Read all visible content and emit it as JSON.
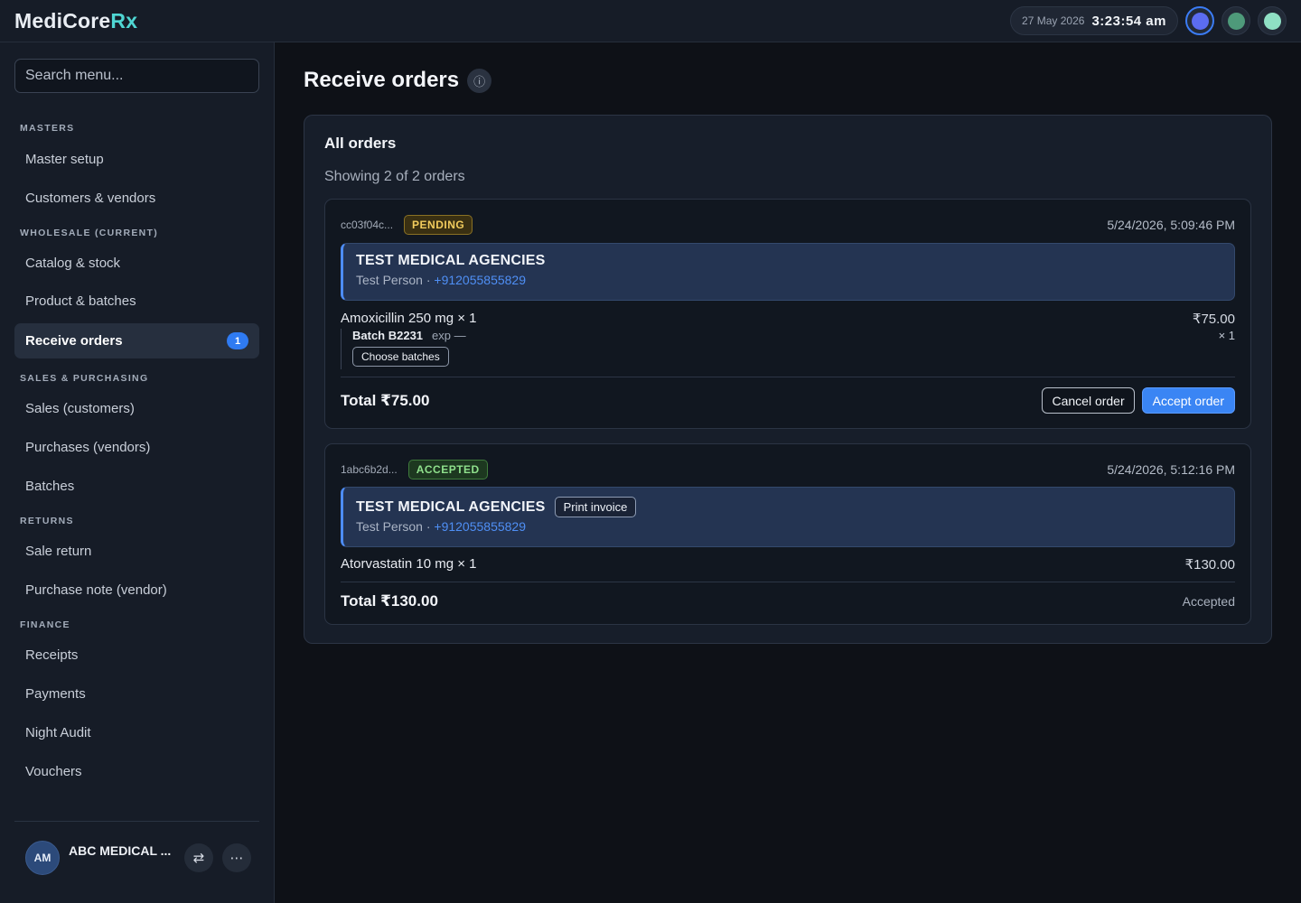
{
  "app": {
    "brand_main": "MediCore",
    "brand_accent": "Rx",
    "clock_date": "27 May 2026",
    "clock_time": "3:23:54 am",
    "themes": [
      {
        "name": "indigo",
        "color": "#5b6cf0"
      },
      {
        "name": "green",
        "color": "#4e9a7a"
      },
      {
        "name": "mint",
        "color": "#8fe0c4"
      }
    ]
  },
  "sidebar": {
    "search_placeholder": "Search menu...",
    "sections": [
      {
        "label": "MASTERS",
        "items": [
          {
            "label": "Master setup"
          },
          {
            "label": "Customers & vendors"
          }
        ]
      },
      {
        "label": "WHOLESALE (CURRENT)",
        "items": [
          {
            "label": "Catalog & stock"
          },
          {
            "label": "Product & batches"
          },
          {
            "label": "Receive orders",
            "badge": "1",
            "active": true
          }
        ]
      },
      {
        "label": "SALES & PURCHASING",
        "items": [
          {
            "label": "Sales (customers)"
          },
          {
            "label": "Purchases (vendors)"
          },
          {
            "label": "Batches"
          }
        ]
      },
      {
        "label": "RETURNS",
        "items": [
          {
            "label": "Sale return"
          },
          {
            "label": "Purchase note (vendor)"
          }
        ]
      },
      {
        "label": "FINANCE",
        "items": [
          {
            "label": "Receipts"
          },
          {
            "label": "Payments"
          },
          {
            "label": "Night Audit"
          },
          {
            "label": "Vouchers"
          }
        ]
      }
    ],
    "account": {
      "initials": "AM",
      "name": "ABC MEDICAL ...",
      "switch_icon": "⇄",
      "more_icon": "⋯"
    }
  },
  "main": {
    "title": "Receive orders",
    "info_icon": "ⓘ",
    "panel_title": "All orders",
    "panel_subtitle": "Showing 2 of 2 orders",
    "orders": [
      {
        "id": "cc03f04c...",
        "status": "PENDING",
        "time": "5/24/2026, 5:09:46 PM",
        "customer": "TEST MEDICAL AGENCIES",
        "contact_person": "Test Person",
        "separator": " · ",
        "phone": "+912055855829",
        "item": "Amoxicillin 250 mg × 1",
        "item_price": "₹75.00",
        "item_qty": "× 1",
        "batch": "Batch B2231",
        "batch_exp": "exp —",
        "choose_batches_label": "Choose batches",
        "total": "Total ₹75.00",
        "cancel_label": "Cancel order",
        "accept_label": "Accept order"
      },
      {
        "id": "1abc6b2d...",
        "status": "ACCEPTED",
        "time": "5/24/2026, 5:12:16 PM",
        "customer": "TEST MEDICAL AGENCIES",
        "print_label": "Print invoice",
        "contact_person": "Test Person",
        "separator": " · ",
        "phone": "+912055855829",
        "item": "Atorvastatin 10 mg × 1",
        "item_price": "₹130.00",
        "total": "Total ₹130.00",
        "status_text": "Accepted"
      }
    ]
  }
}
